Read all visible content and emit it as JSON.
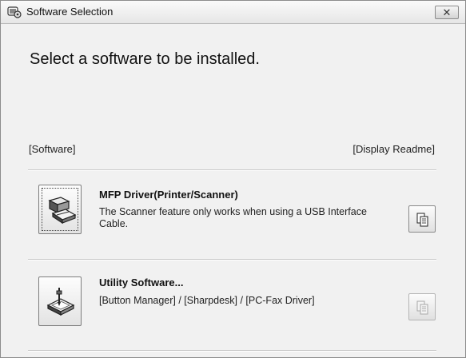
{
  "window": {
    "title": "Software Selection",
    "close_label": "✕"
  },
  "heading": "Select a software to be installed.",
  "columns": {
    "left": "[Software]",
    "right": "[Display Readme]"
  },
  "items": [
    {
      "title": "MFP Driver(Printer/Scanner)",
      "description": "The Scanner feature only works when using a USB Interface Cable.",
      "icon": "printer-scanner-icon",
      "readme_enabled": true
    },
    {
      "title": "Utility Software...",
      "description": "[Button Manager] / [Sharpdesk] / [PC-Fax Driver]",
      "icon": "utility-software-icon",
      "readme_enabled": false
    }
  ]
}
